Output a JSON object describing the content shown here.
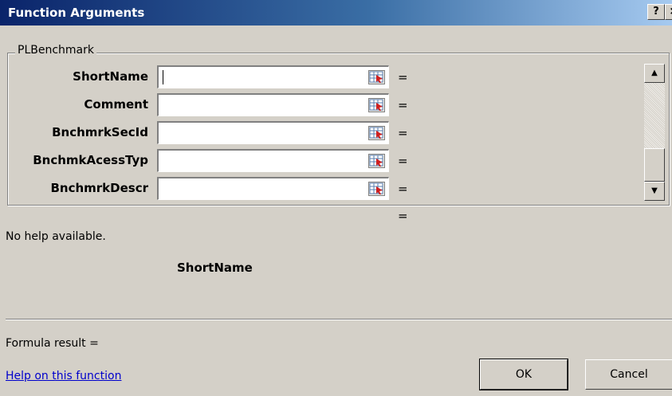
{
  "window": {
    "title": "Function Arguments",
    "help_glyph": "?",
    "close_glyph": "×"
  },
  "group": {
    "title": "PLBenchmark",
    "arguments": [
      {
        "label": "ShortName",
        "value": "",
        "equals": "="
      },
      {
        "label": "Comment",
        "value": "",
        "equals": "="
      },
      {
        "label": "BnchmrkSecId",
        "value": "",
        "equals": "="
      },
      {
        "label": "BnchmkAcessTyp",
        "value": "",
        "equals": "="
      },
      {
        "label": "BnchmrkDescr",
        "value": "",
        "equals": "="
      }
    ],
    "result_equals": "="
  },
  "scrollbar": {
    "up_glyph": "▲",
    "down_glyph": "▼"
  },
  "help": {
    "text": "No help available.",
    "argument_name": "ShortName"
  },
  "formula_result": "Formula result =",
  "help_link": "Help on this function",
  "buttons": {
    "ok": "OK",
    "cancel": "Cancel"
  }
}
